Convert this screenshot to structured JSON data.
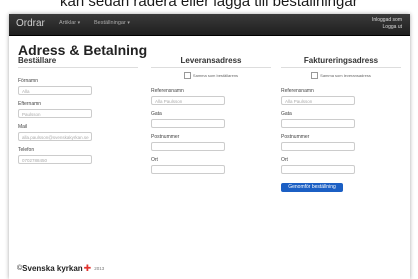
{
  "caption": "kan sedan radera eller lägga till beställningar",
  "navbar": {
    "brand": "Ordrar",
    "items": [
      "Artiklar",
      "Beställningar"
    ],
    "user_line1": "Inloggad som",
    "user_line2": "Logga ut"
  },
  "page": {
    "title": "Adress & Betalning"
  },
  "bestallare": {
    "heading": "Beställare",
    "fields": [
      {
        "label": "Förnamn",
        "placeholder": "Alla"
      },
      {
        "label": "Efternamn",
        "placeholder": "Paulsson"
      },
      {
        "label": "Mail",
        "placeholder": "alla.paulsson@svenskakyrkan.se"
      },
      {
        "label": "Telefon",
        "placeholder": "0702788450"
      }
    ]
  },
  "leverans": {
    "heading": "Leveransadress",
    "checkbox": "Samma som beställarens",
    "fields": [
      {
        "label": "Referensnamn",
        "placeholder": "Alla Paulsson"
      },
      {
        "label": "Gata",
        "placeholder": ""
      },
      {
        "label": "Postnummer",
        "placeholder": ""
      },
      {
        "label": "Ort",
        "placeholder": ""
      }
    ]
  },
  "faktura": {
    "heading": "Faktureringsadress",
    "checkbox": "Samma som leveransadress",
    "fields": [
      {
        "label": "Referensnamn",
        "placeholder": "Alla Paulsson"
      },
      {
        "label": "Gata",
        "placeholder": ""
      },
      {
        "label": "Postnummer",
        "placeholder": ""
      },
      {
        "label": "Ort",
        "placeholder": ""
      }
    ],
    "submit": "Genomför beställning"
  },
  "footer": {
    "brand": "Svenska kyrkan",
    "year": "2013",
    "prefix": "©"
  },
  "colors": {
    "navbar": "#2a2a2a",
    "accent": "#1b5fc4",
    "logo_cross": "#e3342f"
  }
}
